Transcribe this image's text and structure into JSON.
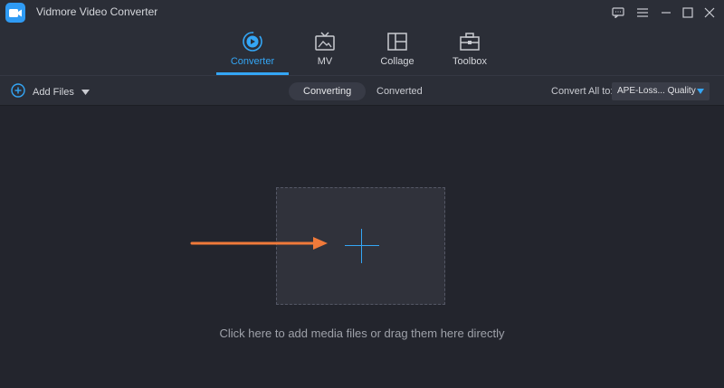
{
  "app": {
    "title": "Vidmore Video Converter",
    "accent_color": "#34a6f5",
    "logo_icon": "video-camera-icon"
  },
  "window_controls": [
    {
      "name": "feedback-icon"
    },
    {
      "name": "menu-icon"
    },
    {
      "name": "minimize-icon"
    },
    {
      "name": "maximize-icon"
    },
    {
      "name": "close-icon"
    }
  ],
  "nav": {
    "tabs": [
      {
        "label": "Converter",
        "icon": "converter-icon",
        "active": true
      },
      {
        "label": "MV",
        "icon": "mv-icon",
        "active": false
      },
      {
        "label": "Collage",
        "icon": "collage-icon",
        "active": false
      },
      {
        "label": "Toolbox",
        "icon": "toolbox-icon",
        "active": false
      }
    ]
  },
  "toolbar": {
    "add_files_label": "Add Files",
    "status_tabs": [
      {
        "label": "Converting",
        "active": true
      },
      {
        "label": "Converted",
        "active": false
      }
    ],
    "convert_all_label": "Convert All to:",
    "format_value": "APE-Loss... Quality"
  },
  "dropzone": {
    "hint": "Click here to add media files or drag them here directly"
  }
}
